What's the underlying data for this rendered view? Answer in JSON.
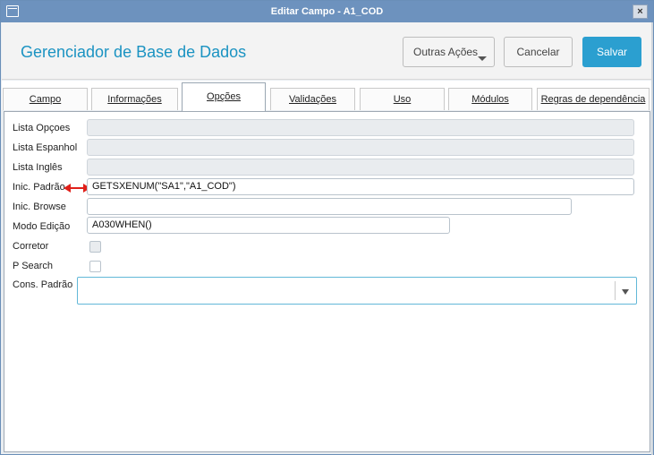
{
  "window": {
    "title": "Editar Campo - A1_COD",
    "close_label": "×"
  },
  "header": {
    "app_title": "Gerenciador de Base de Dados",
    "buttons": {
      "more": "Outras Ações",
      "cancel": "Cancelar",
      "save": "Salvar"
    }
  },
  "tabs": [
    {
      "label": "Campo"
    },
    {
      "label": "Informações"
    },
    {
      "label": "Opções",
      "active": true
    },
    {
      "label": "Validações"
    },
    {
      "label": "Uso"
    },
    {
      "label": "Módulos"
    },
    {
      "label": "Regras de dependência"
    }
  ],
  "form": {
    "lista_opcoes": {
      "label": "Lista Opçoes",
      "value": ""
    },
    "lista_espanhol": {
      "label": "Lista Espanhol",
      "value": ""
    },
    "lista_ingles": {
      "label": "Lista Inglês",
      "value": ""
    },
    "inic_padrao": {
      "label": "Inic. Padrão",
      "value": "GETSXENUM(\"SA1\",\"A1_COD\")"
    },
    "inic_browse": {
      "label": "Inic. Browse",
      "value": ""
    },
    "modo_edicao": {
      "label": "Modo Edição",
      "value": "A030WHEN()"
    },
    "corretor": {
      "label": "Corretor",
      "checked": false
    },
    "p_search": {
      "label": "P Search",
      "checked": false
    },
    "cons_padrao": {
      "label": "Cons. Padrão",
      "value": ""
    }
  },
  "colors": {
    "accent": "#1b93c2",
    "save_button": "#2b9fd0",
    "titlebar": "#6d92be",
    "annotation_arrow": "#e0201a"
  }
}
